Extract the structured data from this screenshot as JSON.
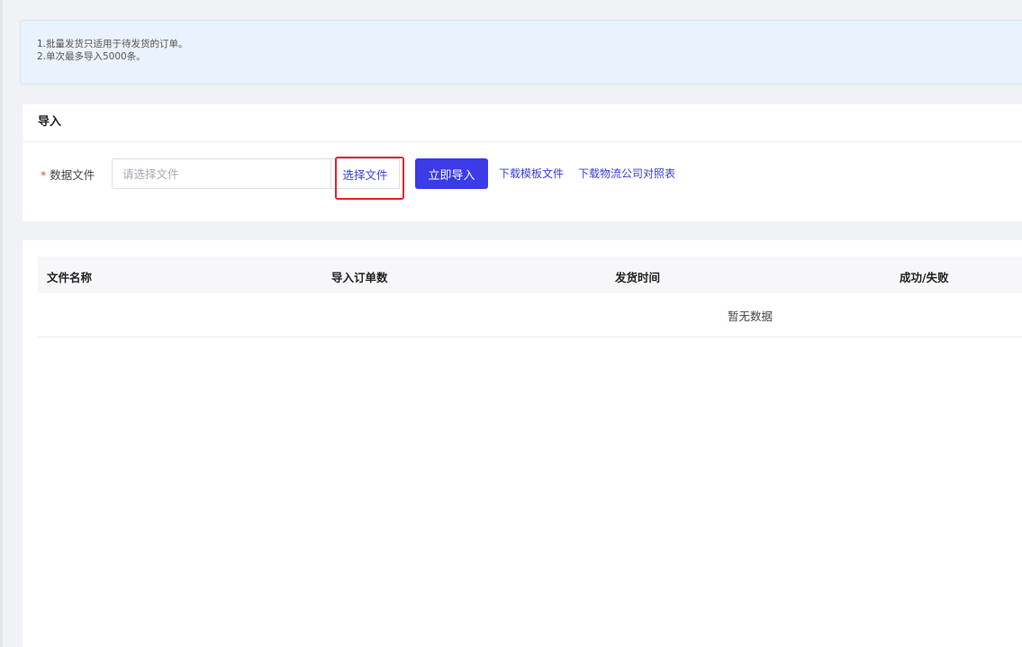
{
  "notice": {
    "line1": "1.批量发货只适用于待发货的订单。",
    "line2": "2.单次最多导入5000条。"
  },
  "import_section": {
    "title": "导入",
    "required_mark": "*",
    "field_label": "数据文件",
    "file_placeholder": "请选择文件",
    "file_value": "",
    "choose_file_label": "选择文件",
    "import_now_label": "立即导入",
    "download_template_label": "下载模板文件",
    "download_logistics_label": "下载物流公司对照表"
  },
  "table": {
    "columns": [
      "文件名称",
      "导入订单数",
      "发货时间",
      "成功/失败"
    ],
    "empty_text": "暂无数据"
  },
  "colors": {
    "primary": "#3b3be8",
    "link": "#3a3fd4",
    "highlight": "#e8212a",
    "notice_bg": "#eaf2fd",
    "page_bg": "#f0f2f5"
  }
}
